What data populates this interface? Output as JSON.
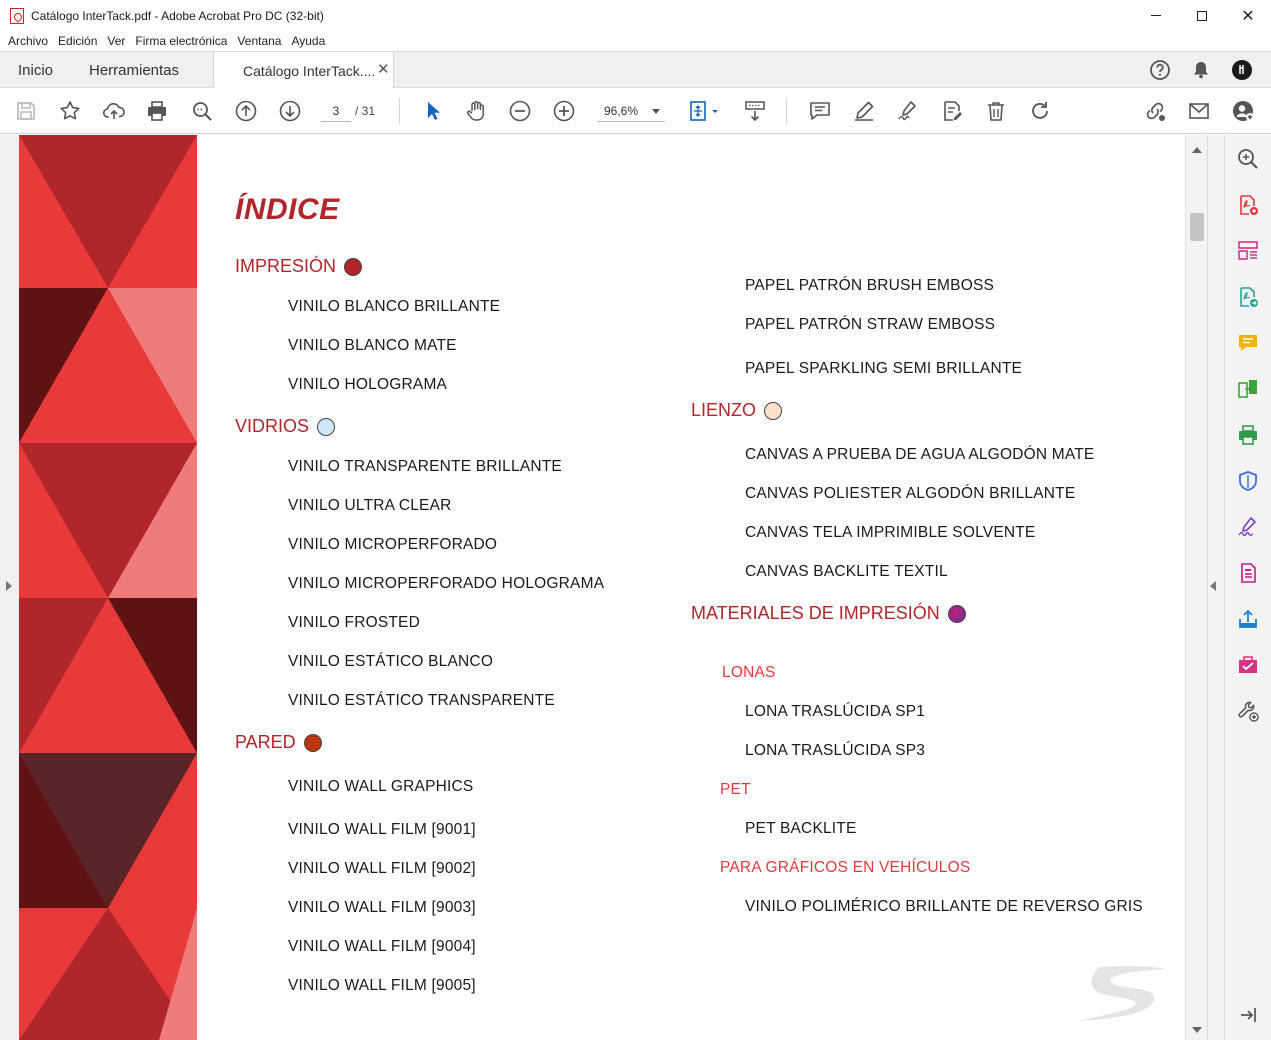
{
  "window": {
    "title": "Catálogo InterTack.pdf - Adobe Acrobat Pro DC (32-bit)",
    "minimize_label": "—",
    "maximize_label": "☐",
    "close_label": "✕"
  },
  "menu": [
    "Archivo",
    "Edición",
    "Ver",
    "Firma electrónica",
    "Ventana",
    "Ayuda"
  ],
  "tabs": {
    "home": "Inicio",
    "tools": "Herramientas",
    "document": "Catálogo InterTack....",
    "close_glyph": "✕"
  },
  "toolbar": {
    "current_page": "3",
    "total_pages": "/ 31",
    "zoom": "96,6%"
  },
  "document": {
    "title": "ÍNDICE",
    "left_column": {
      "impresion": {
        "heading": "IMPRESIÓN",
        "dot_color": "#b0262a",
        "items": [
          "VINILO BLANCO BRILLANTE",
          "VINILO BLANCO MATE",
          "VINILO HOLOGRAMA"
        ]
      },
      "vidrios": {
        "heading": "VIDRIOS",
        "dot_color": "#cfe7f7",
        "items": [
          "VINILO TRANSPARENTE BRILLANTE",
          "VINILO ULTRA CLEAR",
          "VINILO MICROPERFORADO",
          "VINILO MICROPERFORADO HOLOGRAMA",
          "VINILO FROSTED",
          "VINILO ESTÁTICO BLANCO",
          "VINILO ESTÁTICO TRANSPARENTE"
        ]
      },
      "pared": {
        "heading": "PARED",
        "dot_color": "#e07a3a",
        "items": [
          "VINILO WALL GRAPHICS",
          "VINILO WALL FILM  [9001]",
          "VINILO WALL FILM  [9002]",
          "VINILO WALL FILM  [9003]",
          "VINILO WALL FILM  [9004]",
          "VINILO WALL FILM  [9005]"
        ]
      }
    },
    "right_column": {
      "top_items": [
        "PAPEL PATRÓN BRUSH EMBOSS",
        "PAPEL PATRÓN STRAW EMBOSS",
        "PAPEL SPARKLING SEMI BRILLANTE"
      ],
      "lienzo": {
        "heading": "LIENZO",
        "dot_color": "#fbe0cc",
        "items": [
          "CANVAS A PRUEBA DE AGUA ALGODÓN MATE",
          "CANVAS POLIESTER ALGODÓN BRILLANTE",
          "CANVAS TELA IMPRIMIBLE SOLVENTE",
          "CANVAS BACKLITE TEXTIL"
        ]
      },
      "materiales": {
        "heading": "MATERIALES DE IMPRESIÓN",
        "dot_color": "#8a2a8c",
        "lonas": {
          "label": "LONAS",
          "items": [
            "LONA TRASLÚCIDA SP1",
            "LONA TRASLÚCIDA SP3"
          ]
        },
        "pet": {
          "label": "PET",
          "items": [
            "PET BACKLITE"
          ]
        },
        "vehiculos": {
          "label": "PARA GRÁFICOS EN VEHÍCULOS",
          "items": [
            "VINILO POLIMÉRICO BRILLANTE DE REVERSO GRIS"
          ]
        }
      }
    }
  },
  "colors": {
    "heading_red": "#b0262a",
    "subsection_red": "#e0393c",
    "deco_red": "#e8393b",
    "deco_dark": "#5e1214"
  }
}
